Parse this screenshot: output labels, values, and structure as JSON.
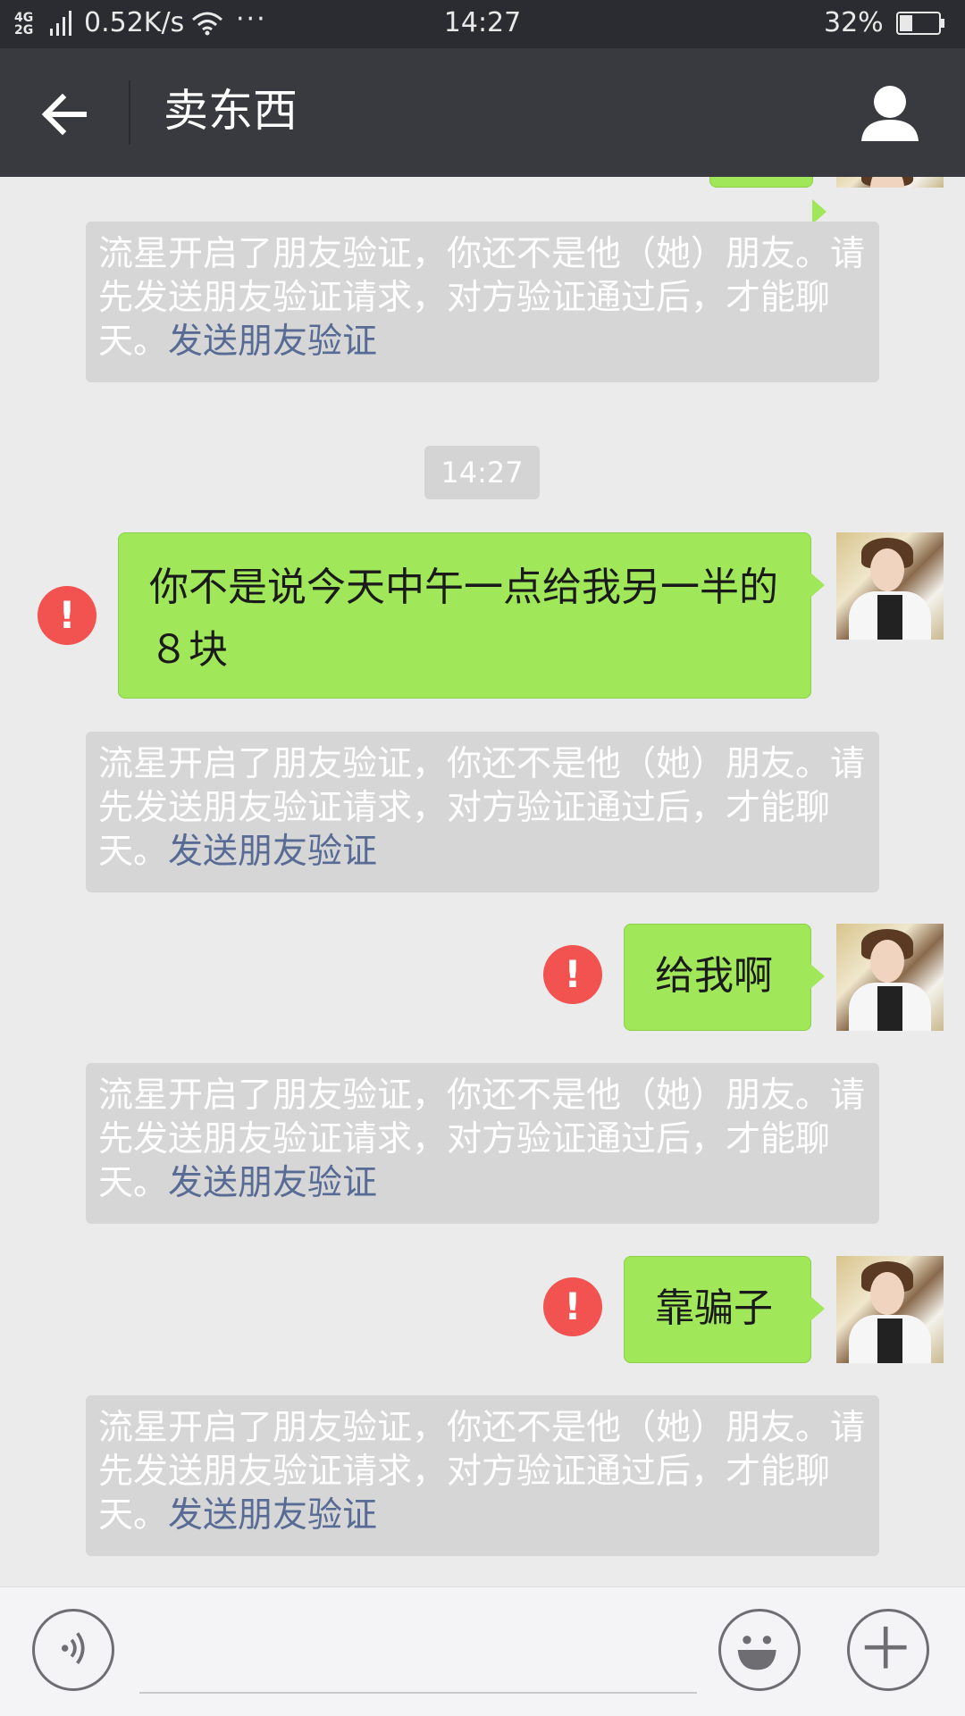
{
  "status_bar": {
    "network_top": "4G",
    "network_bottom": "2G",
    "speed": "0.52K/s",
    "more": "···",
    "time": "14:27",
    "battery": "32%"
  },
  "nav": {
    "title": "卖东西",
    "back_icon": "arrow-left-icon",
    "profile_icon": "person-icon"
  },
  "system_notice": {
    "text": "流星开启了朋友验证，你还不是他（她）朋友。请先发送朋友验证请求，对方验证通过后，才能聊天。",
    "link": "发送朋友验证"
  },
  "chat": {
    "timestamp": "14:27",
    "messages": [
      {
        "text": "你不是说今天中午一点给我另一半的８块",
        "status": "failed"
      },
      {
        "text": "给我啊",
        "status": "failed"
      },
      {
        "text": "靠骗子",
        "status": "failed"
      }
    ]
  },
  "input_bar": {
    "voice_icon": "voice-icon",
    "emoji_icon": "emoji-icon",
    "plus_icon": "plus-icon"
  },
  "colors": {
    "status_bar_bg": "#2b2c31",
    "nav_bg": "#393a3f",
    "chat_bg": "#ebebeb",
    "bubble_green": "#a0e75a",
    "error_red": "#f25250",
    "link_blue": "#576b95"
  }
}
